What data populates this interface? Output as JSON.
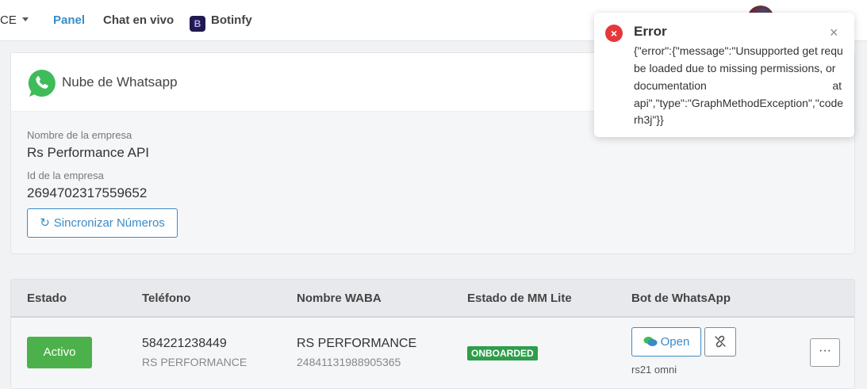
{
  "nav": {
    "ce_label": "CE",
    "panel_label": "Panel",
    "chat_label": "Chat en vivo",
    "botinfy_label": "Botinfy"
  },
  "card": {
    "title": "Nube de Whatsapp",
    "company_name_label": "Nombre de la empresa",
    "company_name_value": "Rs Performance API",
    "company_id_label": "Id de la empresa",
    "company_id_value": "2694702317559652",
    "sync_button_label": "Sincronizar Números"
  },
  "table": {
    "headers": [
      "Estado",
      "Teléfono",
      "Nombre WABA",
      "Estado de MM Lite",
      "Bot de WhatsApp"
    ],
    "rows": [
      {
        "status": "Activo",
        "phone": "584221238449",
        "phone_name": "RS PERFORMANCE",
        "waba_name": "RS PERFORMANCE",
        "waba_id": "24841131988905365",
        "mm_lite_status": "ONBOARDED",
        "bot_open_label": "Open",
        "bot_name": "rs21 omni",
        "more_label": "···"
      }
    ]
  },
  "toast": {
    "title": "Error",
    "close_label": "×",
    "line1": "{\"error\":{\"message\":\"Unsupported get requ",
    "line2": "be loaded due to missing permissions, or",
    "line3_left": "documentation",
    "line3_right": "at",
    "line4": "api\",\"type\":\"GraphMethodException\",\"code",
    "line5": "rh3j\"}}"
  },
  "colors": {
    "accent": "#3a8bc6",
    "active_green": "#4cb14a",
    "onboarded_green": "#2e9e4a",
    "error_red": "#e5383b"
  },
  "icons": [
    "whatsapp-icon",
    "sync-icon",
    "chat-bubbles-icon",
    "unlink-icon",
    "error-icon",
    "close-icon",
    "caret-down-icon",
    "botinfy-logo"
  ]
}
